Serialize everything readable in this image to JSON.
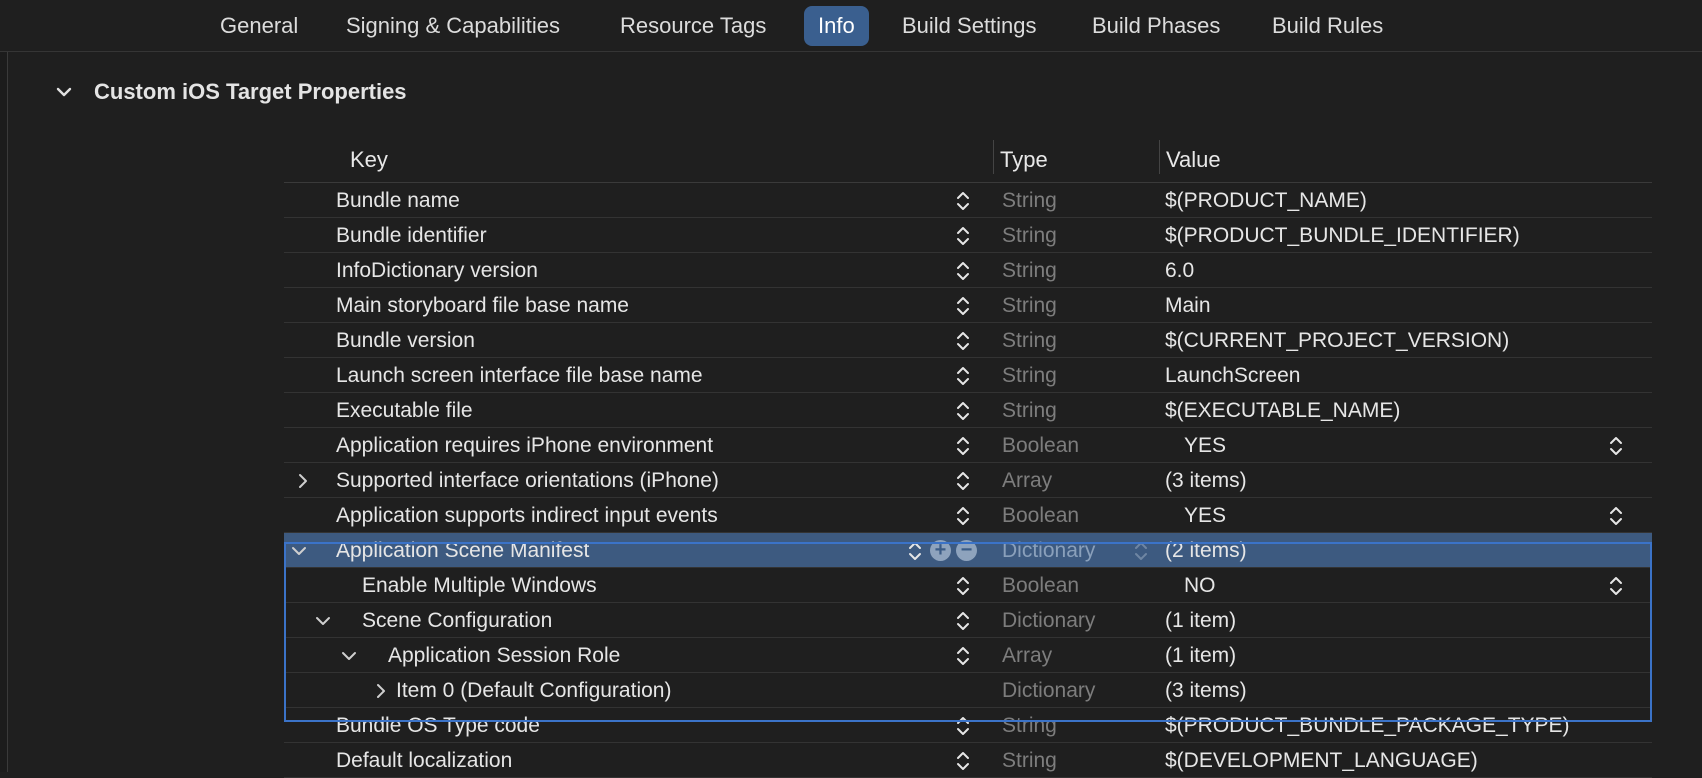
{
  "tabs": [
    {
      "label": "General",
      "active": false
    },
    {
      "label": "Signing & Capabilities",
      "active": false
    },
    {
      "label": "Resource Tags",
      "active": false
    },
    {
      "label": "Info",
      "active": true
    },
    {
      "label": "Build Settings",
      "active": false
    },
    {
      "label": "Build Phases",
      "active": false
    },
    {
      "label": "Build Rules",
      "active": false
    }
  ],
  "section": {
    "title": "Custom iOS Target Properties"
  },
  "table": {
    "headers": {
      "key": "Key",
      "type": "Type",
      "value": "Value"
    },
    "rows": [
      {
        "key": "Bundle name",
        "type": "String",
        "value": "$(PRODUCT_NAME)"
      },
      {
        "key": "Bundle identifier",
        "type": "String",
        "value": "$(PRODUCT_BUNDLE_IDENTIFIER)"
      },
      {
        "key": "InfoDictionary version",
        "type": "String",
        "value": "6.0"
      },
      {
        "key": "Main storyboard file base name",
        "type": "String",
        "value": "Main"
      },
      {
        "key": "Bundle version",
        "type": "String",
        "value": "$(CURRENT_PROJECT_VERSION)"
      },
      {
        "key": "Launch screen interface file base name",
        "type": "String",
        "value": "LaunchScreen"
      },
      {
        "key": "Executable file",
        "type": "String",
        "value": "$(EXECUTABLE_NAME)"
      },
      {
        "key": "Application requires iPhone environment",
        "type": "Boolean",
        "value": "YES"
      },
      {
        "key": "Supported interface orientations (iPhone)",
        "type": "Array",
        "value": "(3 items)"
      },
      {
        "key": "Application supports indirect input events",
        "type": "Boolean",
        "value": "YES"
      },
      {
        "key": "Application Scene Manifest",
        "type": "Dictionary",
        "value": "(2 items)"
      },
      {
        "key": "Enable Multiple Windows",
        "type": "Boolean",
        "value": "NO"
      },
      {
        "key": "Scene Configuration",
        "type": "Dictionary",
        "value": "(1 item)"
      },
      {
        "key": "Application Session Role",
        "type": "Array",
        "value": "(1 item)"
      },
      {
        "key": "Item 0 (Default Configuration)",
        "type": "Dictionary",
        "value": "(3 items)"
      },
      {
        "key": "Bundle OS Type code",
        "type": "String",
        "value": "$(PRODUCT_BUNDLE_PACKAGE_TYPE)"
      },
      {
        "key": "Default localization",
        "type": "String",
        "value": "$(DEVELOPMENT_LANGUAGE)"
      }
    ]
  },
  "colors": {
    "accent": "#3a5f8f",
    "selection": "#3d5a80",
    "group_border": "#3b73c8"
  },
  "icons": {
    "disclosure": "chevron-icon",
    "stepper": "up-down-stepper-icon",
    "add": "plus-circle-icon",
    "remove": "minus-circle-icon"
  }
}
